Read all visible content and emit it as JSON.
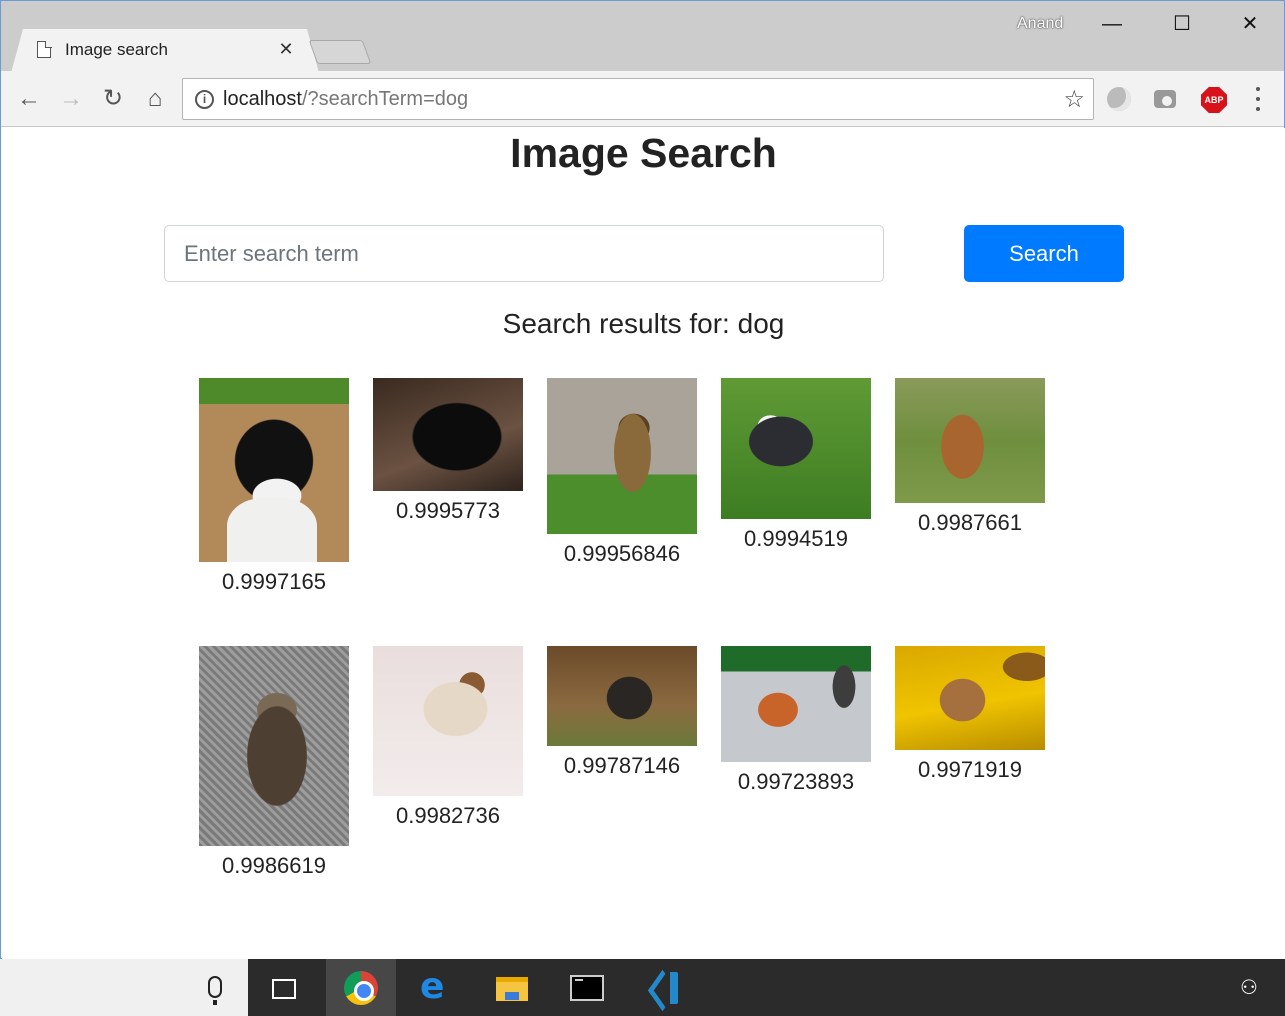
{
  "browser": {
    "tab_title": "Image search",
    "tab_close": "✕",
    "profile_name": "Anand",
    "window_controls": {
      "minimize": "—",
      "maximize": "☐",
      "close": "✕"
    },
    "url_host": "localhost",
    "url_rest": "/?searchTerm=dog",
    "extensions": {
      "abp_label": "ABP"
    }
  },
  "page": {
    "title": "Image Search",
    "search_placeholder": "Enter search term",
    "search_value": "",
    "search_button": "Search",
    "results_heading": "Search results for: dog",
    "results": [
      {
        "score": "0.9997165",
        "image": "dog photo: black and white spaniel"
      },
      {
        "score": "0.9995773",
        "image": "dog photo: black labrador puppy"
      },
      {
        "score": "0.99956846",
        "image": "dog photo: german shepherd on grass"
      },
      {
        "score": "0.9994519",
        "image": "dog photo: black and white pit bull running"
      },
      {
        "score": "0.9987661",
        "image": "dog photo: brown dog sitting in field"
      },
      {
        "score": "0.9986619",
        "image": "dog photo: yorkshire terrier"
      },
      {
        "score": "0.9982736",
        "image": "dog photo: setter in snow"
      },
      {
        "score": "0.99787146",
        "image": "dog photo: shepherd puppy"
      },
      {
        "score": "0.99723893",
        "image": "dog photo: basenji on pavement"
      },
      {
        "score": "0.9971919",
        "image": "dog photo: chihuahua on yellow blanket"
      }
    ]
  },
  "colors": {
    "accent": "#007bff",
    "taskbar": "#2b2b2b",
    "titlebar": "#cccccc"
  },
  "taskbar": {
    "icons": [
      "mic-icon",
      "task-view-icon",
      "chrome-icon",
      "edge-icon",
      "file-explorer-icon",
      "command-prompt-icon",
      "vscode-icon",
      "people-icon"
    ]
  }
}
